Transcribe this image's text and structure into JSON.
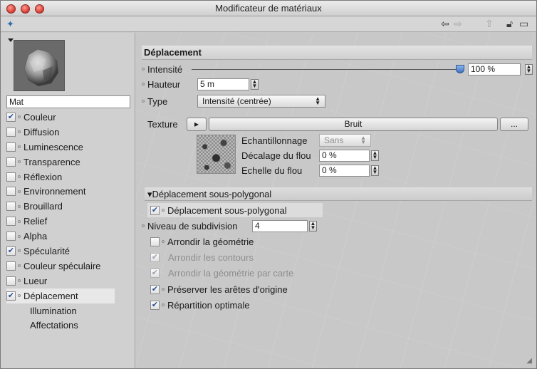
{
  "window": {
    "title": "Modificateur de matériaux"
  },
  "left": {
    "material_name": "Mat",
    "channels": [
      {
        "label": "Couleur",
        "checked": true
      },
      {
        "label": "Diffusion",
        "checked": false
      },
      {
        "label": "Luminescence",
        "checked": false
      },
      {
        "label": "Transparence",
        "checked": false
      },
      {
        "label": "Réflexion",
        "checked": false
      },
      {
        "label": "Environnement",
        "checked": false
      },
      {
        "label": "Brouillard",
        "checked": false
      },
      {
        "label": "Relief",
        "checked": false
      },
      {
        "label": "Alpha",
        "checked": false
      },
      {
        "label": "Spécularité",
        "checked": true
      },
      {
        "label": "Couleur spéculaire",
        "checked": false
      },
      {
        "label": "Lueur",
        "checked": false
      },
      {
        "label": "Déplacement",
        "checked": true,
        "selected": true
      }
    ],
    "extra_items": [
      "Illumination",
      "Affectations"
    ]
  },
  "section": {
    "title": "Déplacement",
    "intensite_label": "Intensité",
    "intensite_value": "100 %",
    "intensite_fraction": 1.0,
    "hauteur_label": "Hauteur",
    "hauteur_value": "5 m",
    "type_label": "Type",
    "type_value": "Intensité (centrée)",
    "texture_label": "Texture",
    "texture_name": "Bruit",
    "texture_more": "...",
    "echantillonnage_label": "Echantillonnage",
    "echantillonnage_value": "Sans",
    "decalage_label": "Décalage du flou",
    "decalage_value": "0 %",
    "echelle_label": "Echelle du flou",
    "echelle_value": "0 %"
  },
  "subpoly": {
    "title": "Déplacement sous-polygonal",
    "enable_label": "Déplacement sous-polygonal",
    "niveau_label": "Niveau de subdivision",
    "niveau_value": "4",
    "options": [
      {
        "label": "Arrondir la géométrie",
        "checked": false,
        "enabled": true
      },
      {
        "label": "Arrondir les contours",
        "checked": true,
        "enabled": false
      },
      {
        "label": "Arrondir la géométrie par carte",
        "checked": true,
        "enabled": false
      },
      {
        "label": "Préserver les arêtes d'origine",
        "checked": true,
        "enabled": true
      },
      {
        "label": "Répartition optimale",
        "checked": true,
        "enabled": true
      }
    ]
  },
  "colors": {
    "accent": "#3b72c4",
    "check": "#2a4f9a"
  }
}
